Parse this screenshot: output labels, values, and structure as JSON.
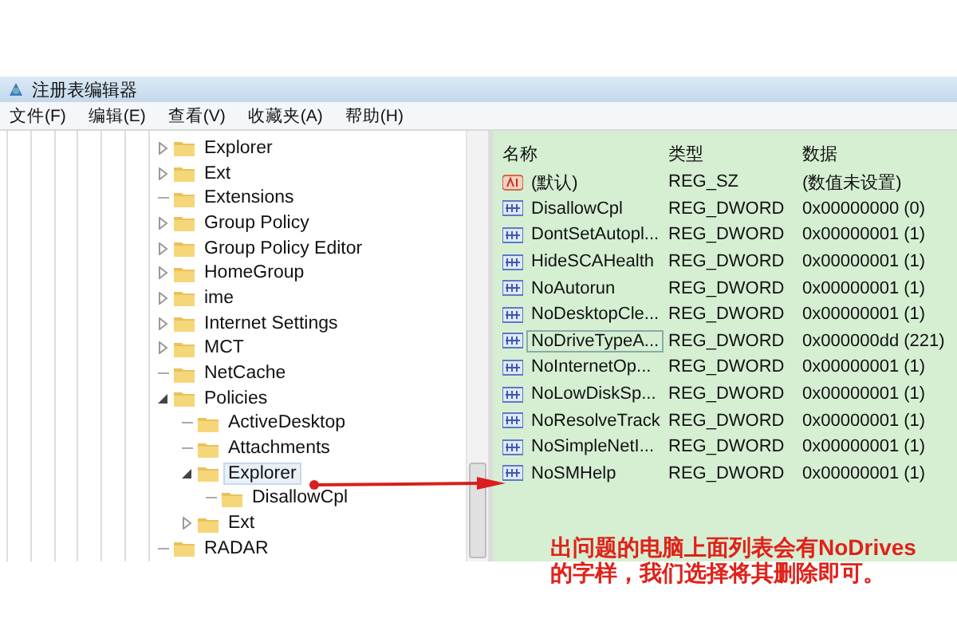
{
  "window": {
    "title": "注册表编辑器"
  },
  "menu": [
    "文件(F)",
    "编辑(E)",
    "查看(V)",
    "收藏夹(A)",
    "帮助(H)"
  ],
  "tree": [
    {
      "label": "Explorer",
      "kind": "branch",
      "expanded": false,
      "selected": false
    },
    {
      "label": "Ext",
      "kind": "branch",
      "expanded": false,
      "selected": false
    },
    {
      "label": "Extensions",
      "kind": "leaf",
      "selected": false
    },
    {
      "label": "Group Policy",
      "kind": "branch",
      "expanded": false,
      "selected": false
    },
    {
      "label": "Group Policy Editor",
      "kind": "branch",
      "expanded": false,
      "selected": false
    },
    {
      "label": "HomeGroup",
      "kind": "branch",
      "expanded": false,
      "selected": false
    },
    {
      "label": "ime",
      "kind": "branch",
      "expanded": false,
      "selected": false
    },
    {
      "label": "Internet Settings",
      "kind": "branch",
      "expanded": false,
      "selected": false
    },
    {
      "label": "MCT",
      "kind": "branch",
      "expanded": false,
      "selected": false
    },
    {
      "label": "NetCache",
      "kind": "leaf",
      "selected": false
    },
    {
      "label": "Policies",
      "kind": "branch",
      "expanded": true,
      "selected": false,
      "children": [
        {
          "label": "ActiveDesktop",
          "kind": "leaf",
          "selected": false
        },
        {
          "label": "Attachments",
          "kind": "leaf",
          "selected": false
        },
        {
          "label": "Explorer",
          "kind": "branch",
          "expanded": true,
          "selected": true,
          "children": [
            {
              "label": "DisallowCpl",
              "kind": "leaf",
              "selected": false
            }
          ]
        },
        {
          "label": "Ext",
          "kind": "branch",
          "expanded": false,
          "selected": false
        }
      ]
    },
    {
      "label": "RADAR",
      "kind": "leaf",
      "selected": false
    }
  ],
  "list": {
    "columns": [
      "名称",
      "类型",
      "数据"
    ],
    "rows": [
      {
        "kind": "string",
        "name": "(默认)",
        "type": "REG_SZ",
        "data": "(数值未设置)",
        "selected": false
      },
      {
        "kind": "dword",
        "name": "DisallowCpl",
        "type": "REG_DWORD",
        "data": "0x00000000 (0)",
        "selected": false
      },
      {
        "kind": "dword",
        "name": "DontSetAutopl...",
        "type": "REG_DWORD",
        "data": "0x00000001 (1)",
        "selected": false
      },
      {
        "kind": "dword",
        "name": "HideSCAHealth",
        "type": "REG_DWORD",
        "data": "0x00000001 (1)",
        "selected": false
      },
      {
        "kind": "dword",
        "name": "NoAutorun",
        "type": "REG_DWORD",
        "data": "0x00000001 (1)",
        "selected": false
      },
      {
        "kind": "dword",
        "name": "NoDesktopCle...",
        "type": "REG_DWORD",
        "data": "0x00000001 (1)",
        "selected": false
      },
      {
        "kind": "dword",
        "name": "NoDriveTypeA...",
        "type": "REG_DWORD",
        "data": "0x000000dd (221)",
        "selected": true
      },
      {
        "kind": "dword",
        "name": "NoInternetOp...",
        "type": "REG_DWORD",
        "data": "0x00000001 (1)",
        "selected": false
      },
      {
        "kind": "dword",
        "name": "NoLowDiskSp...",
        "type": "REG_DWORD",
        "data": "0x00000001 (1)",
        "selected": false
      },
      {
        "kind": "dword",
        "name": "NoResolveTrack",
        "type": "REG_DWORD",
        "data": "0x00000001 (1)",
        "selected": false
      },
      {
        "kind": "dword",
        "name": "NoSimpleNetI...",
        "type": "REG_DWORD",
        "data": "0x00000001 (1)",
        "selected": false
      },
      {
        "kind": "dword",
        "name": "NoSMHelp",
        "type": "REG_DWORD",
        "data": "0x00000001 (1)",
        "selected": false
      }
    ]
  },
  "annotation": {
    "text": "出问题的电脑上面列表会有NoDrives的字样，我们选择将其删除即可。"
  }
}
